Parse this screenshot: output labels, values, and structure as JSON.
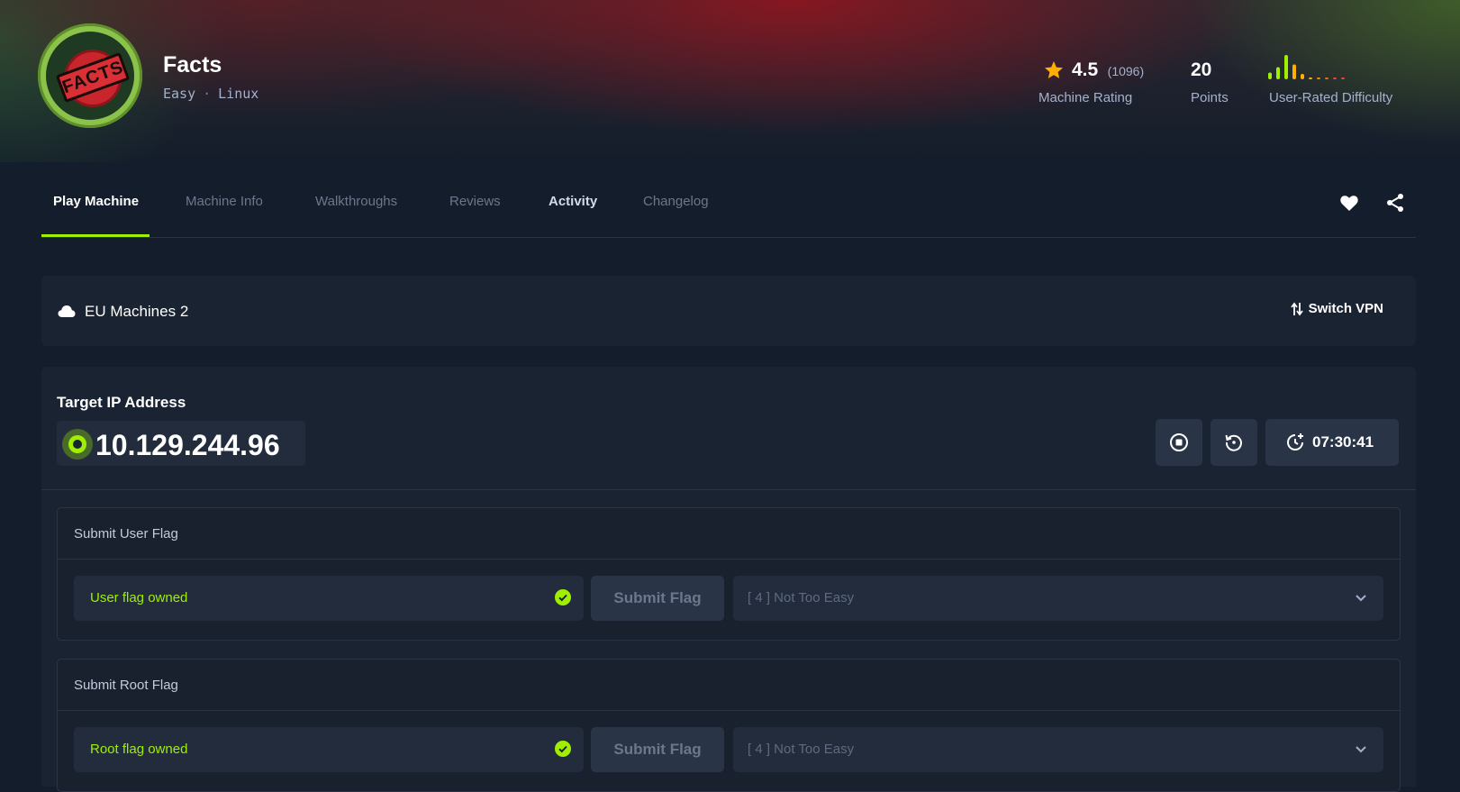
{
  "machine": {
    "name": "Facts",
    "difficulty": "Easy",
    "separator": "·",
    "os": "Linux",
    "logo_text": "FACTS"
  },
  "stats": {
    "rating": "4.5",
    "rating_count": "(1096)",
    "rating_label": "Machine Rating",
    "points": "20",
    "points_label": "Points",
    "difficulty_label": "User-Rated Difficulty",
    "difficulty_distribution": [
      0.25,
      0.45,
      0.9,
      0.55,
      0.2,
      0.05,
      0.05,
      0.05,
      0.05,
      0.05
    ]
  },
  "tabs": [
    {
      "label": "Play Machine"
    },
    {
      "label": "Machine Info"
    },
    {
      "label": "Walkthroughs"
    },
    {
      "label": "Reviews"
    },
    {
      "label": "Activity"
    },
    {
      "label": "Changelog"
    }
  ],
  "icons": {
    "favorite": "heart-icon",
    "share": "share-icon",
    "vpn": "cloud-icon",
    "switch": "switch-arrows-icon",
    "stop": "stop-icon",
    "reset": "reset-icon",
    "timer": "timer-icon",
    "owned": "check-circle-icon",
    "dropdown": "chevron-down-icon"
  },
  "vpn": {
    "server": "EU Machines 2",
    "switch_label": "Switch VPN"
  },
  "target": {
    "label": "Target IP Address",
    "ip": "10.129.244.96",
    "timer": "07:30:41"
  },
  "flags": {
    "user": {
      "title": "Submit User Flag",
      "status": "User flag owned",
      "submit_label": "Submit Flag",
      "difficulty": "[ 4 ] Not Too Easy"
    },
    "root": {
      "title": "Submit Root Flag",
      "status": "Root flag owned",
      "submit_label": "Submit Flag",
      "difficulty": "[ 4 ] Not Too Easy"
    }
  },
  "colors": {
    "accent": "#9fef00",
    "background": "#141d2b",
    "panel": "#1a2332",
    "star": "#ffaf00",
    "muted": "#a4b1cd"
  }
}
